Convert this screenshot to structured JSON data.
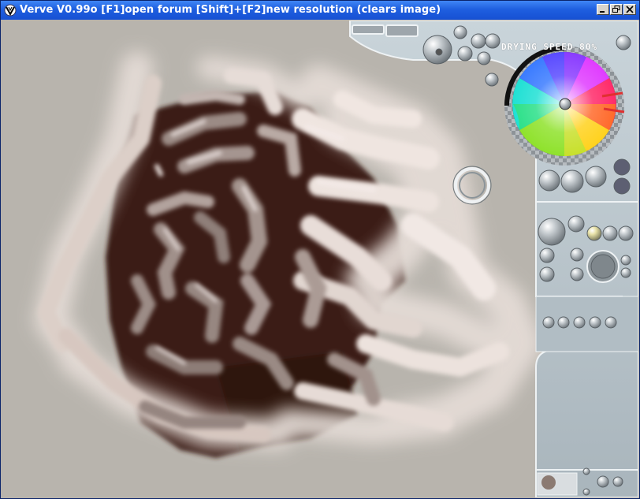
{
  "window": {
    "title": "Verve V0.99o [F1]open forum    [Shift]+[F2]new resolution (clears image)",
    "controls": [
      "minimize",
      "maximize",
      "close"
    ]
  },
  "panel": {
    "drying_speed": "DRYING SPEED 80%",
    "icons": {
      "color_wheel": "color-wheel-icon",
      "brush_cursor": "ring-cursor-icon"
    }
  },
  "colors": {
    "title_bar": "#1f5fe0",
    "canvas": "#b7b3ac",
    "panel": "#b9c5cc",
    "paint_dark": "#3a1d14",
    "paint_light": "#efe4df"
  }
}
